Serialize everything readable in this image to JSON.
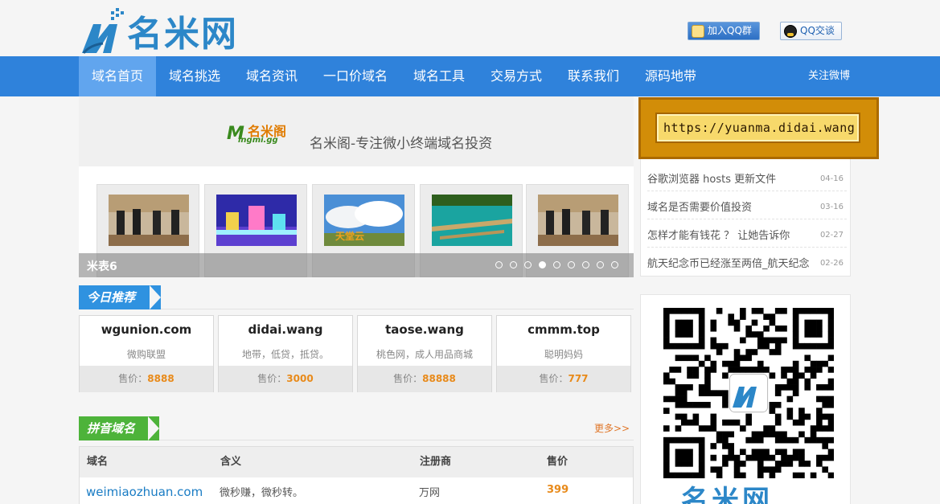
{
  "header": {
    "logo_text": "名米网",
    "qq_group_label": "加入QQ群",
    "qq_chat_label": "QQ交谈"
  },
  "nav": {
    "items": [
      "域名首页",
      "域名挑选",
      "域名资讯",
      "一口价域名",
      "域名工具",
      "交易方式",
      "联系我们",
      "源码地带"
    ],
    "active_index": 0,
    "weibo_label": "关注微博"
  },
  "banner": {
    "logo_cn": "名米阁",
    "logo_en": "ingmi.gg",
    "slogan": "名米阁-专注微小终端域名投资"
  },
  "slider": {
    "caption": "米表6",
    "dot_count": 9,
    "active_dot": 3,
    "thumb_labels": [
      "天堂云"
    ]
  },
  "url_banner": {
    "text": "https://yuanma.didai.wang"
  },
  "news": [
    {
      "title": "谷歌浏览器 hosts 更新文件",
      "date": "04-16"
    },
    {
      "title": "域名是否需要价值投资",
      "date": "03-16"
    },
    {
      "title": "怎样才能有钱花 ？ 让她告诉你",
      "date": "02-27"
    },
    {
      "title": "航天纪念币已经涨至两倍_航天纪念",
      "date": "02-26"
    }
  ],
  "recommend": {
    "title": "今日推荐",
    "price_label": "售价：",
    "cards": [
      {
        "domain": "wgunion.com",
        "desc": "微购联盟",
        "price": "8888"
      },
      {
        "domain": "didai.wang",
        "desc": "地带，低贷，抵贷。",
        "price": "3000"
      },
      {
        "domain": "taose.wang",
        "desc": "桃色网，成人用品商城",
        "price": "88888"
      },
      {
        "domain": "cmmm.top",
        "desc": "聪明妈妈",
        "price": "777"
      }
    ]
  },
  "pinyin": {
    "title": "拼音域名",
    "more": "更多>>",
    "columns": [
      "域名",
      "含义",
      "注册商",
      "售价"
    ],
    "rows": [
      {
        "domain": "weimiaozhuan.com",
        "meaning": "微秒赚，微秒转。",
        "registrar": "万网",
        "price": "399"
      }
    ]
  },
  "qr": {
    "brand": "名米网"
  }
}
